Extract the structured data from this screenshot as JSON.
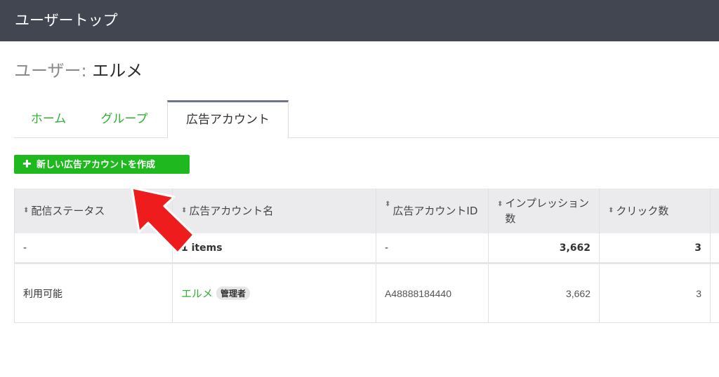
{
  "header": {
    "title": "ユーザートップ"
  },
  "page": {
    "title_prefix": "ユーザー:",
    "title_name": "エルメ"
  },
  "tabs": [
    {
      "label": "ホーム"
    },
    {
      "label": "グループ"
    },
    {
      "label": "広告アカウント",
      "active": true
    }
  ],
  "toolbar": {
    "create_button_label": "新しい広告アカウントを作成"
  },
  "table": {
    "columns": [
      {
        "label": "配信ステータス"
      },
      {
        "label": "広告アカウント名"
      },
      {
        "label": "広告アカウントID"
      },
      {
        "label": "インプレッション数"
      },
      {
        "label": "クリック数"
      }
    ],
    "summary": {
      "status": "-",
      "name": "1 items",
      "id": "-",
      "impressions": "3,662",
      "clicks": "3"
    },
    "rows": [
      {
        "status": "利用可能",
        "name": "エルメ",
        "badge": "管理者",
        "id": "A48888184440",
        "impressions": "3,662",
        "clicks": "3"
      }
    ]
  },
  "colors": {
    "topbar": "#414651",
    "accent_green": "#1fb91f",
    "link_green": "#2fb22f",
    "annotation_red": "#ee1c1c"
  }
}
